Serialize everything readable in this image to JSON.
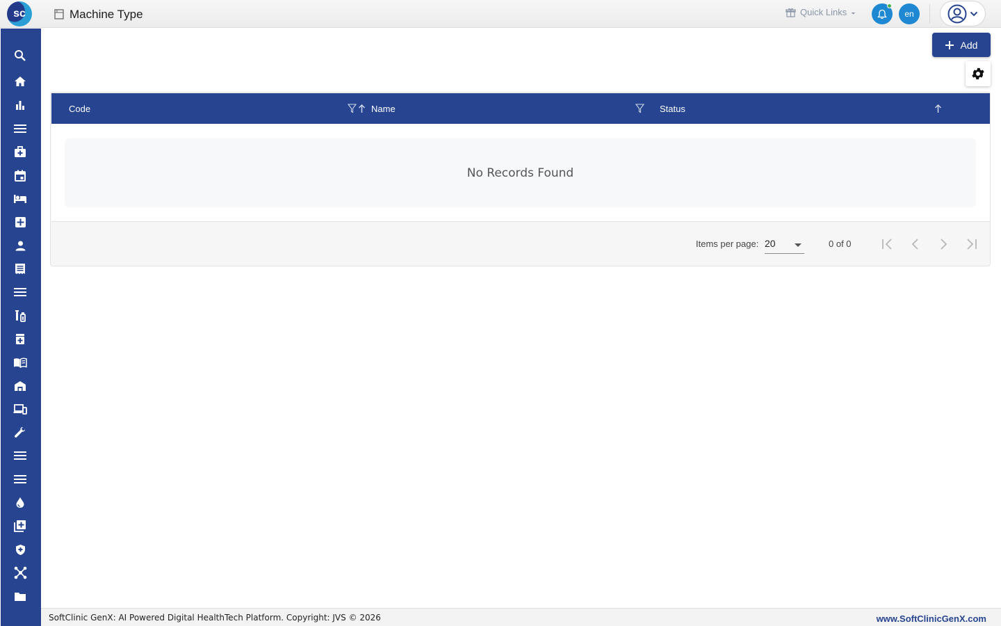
{
  "header": {
    "logo_text": "sc",
    "page_title": "Machine Type",
    "quick_links_label": "Quick Links",
    "language": "en"
  },
  "sidebar": {
    "items": [
      {
        "icon": "search-icon"
      },
      {
        "icon": "home-icon"
      },
      {
        "icon": "bar-chart-icon"
      },
      {
        "icon": "menu-icon"
      },
      {
        "icon": "medical-bag-icon"
      },
      {
        "icon": "calendar-icon"
      },
      {
        "icon": "bed-icon"
      },
      {
        "icon": "medical-cross-icon"
      },
      {
        "icon": "person-icon"
      },
      {
        "icon": "receipt-icon"
      },
      {
        "icon": "menu-icon"
      },
      {
        "icon": "lab-tubes-icon"
      },
      {
        "icon": "pharmacy-icon"
      },
      {
        "icon": "book-icon"
      },
      {
        "icon": "warehouse-icon"
      },
      {
        "icon": "devices-icon"
      },
      {
        "icon": "wrench-icon"
      },
      {
        "icon": "menu-icon"
      },
      {
        "icon": "menu-icon"
      },
      {
        "icon": "blood-drop-icon"
      },
      {
        "icon": "add-library-icon"
      },
      {
        "icon": "shield-icon"
      },
      {
        "icon": "network-icon"
      },
      {
        "icon": "folder-icon"
      }
    ]
  },
  "toolbar": {
    "add_label": "Add"
  },
  "table": {
    "columns": [
      "Code",
      "Name",
      "Status"
    ],
    "empty_message": "No Records Found"
  },
  "paginator": {
    "items_per_page_label": "Items per page:",
    "items_per_page_value": "20",
    "range_label": "0 of 0"
  },
  "footer": {
    "copyright": "SoftClinic GenX: AI Powered Digital HealthTech Platform. Copyright: JVS © 2026",
    "website": "www.SoftClinicGenX.com"
  },
  "colors": {
    "primary": "#26448f",
    "accent": "#1e88d3",
    "notification_dot": "#4caf50"
  }
}
